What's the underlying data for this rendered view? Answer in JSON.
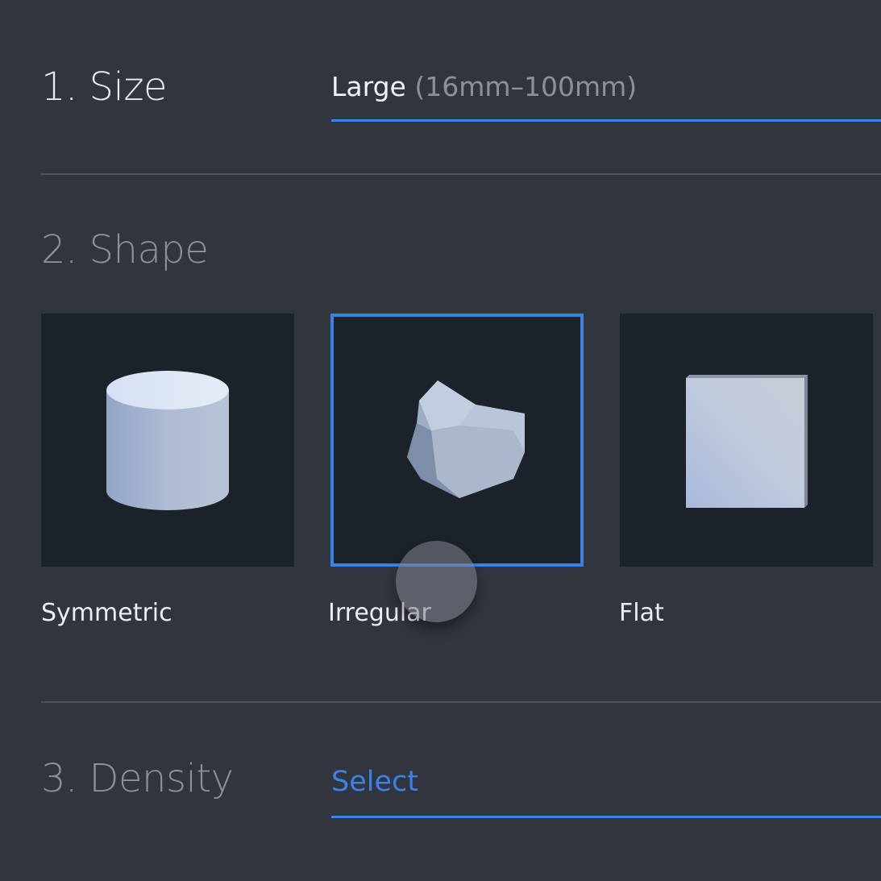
{
  "size": {
    "title": "1. Size",
    "value": "Large",
    "range": "(16mm–100mm)"
  },
  "shape": {
    "title": "2. Shape",
    "selected": "Irregular",
    "options": [
      {
        "label": "Symmetric",
        "icon": "cylinder-icon"
      },
      {
        "label": "Irregular",
        "icon": "irregular-rock-icon"
      },
      {
        "label": "Flat",
        "icon": "flat-slab-icon"
      }
    ]
  },
  "density": {
    "title": "3. Density",
    "placeholder": "Select"
  },
  "colors": {
    "background": "#31353e",
    "card": "#1c222a",
    "accent": "#3c82e6",
    "muted_text": "#8b909b"
  }
}
